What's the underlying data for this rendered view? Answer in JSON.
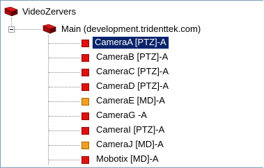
{
  "tree": {
    "root": {
      "label": "VideoZervers",
      "icon": "server-group-icon"
    },
    "server": {
      "label": "Main (development.tridenttek.com)",
      "icon": "server-icon",
      "expanded": true
    },
    "cameras": [
      {
        "label": "CameraA [PTZ]-A",
        "status_color": "#dd1111",
        "selected": true
      },
      {
        "label": "CameraB [PTZ]-A",
        "status_color": "#dd1111",
        "selected": false
      },
      {
        "label": "CameraC [PTZ]-A",
        "status_color": "#dd1111",
        "selected": false
      },
      {
        "label": "CameraD [PTZ]-A",
        "status_color": "#dd1111",
        "selected": false
      },
      {
        "label": "CameraE [MD]-A",
        "status_color": "#f0a020",
        "selected": false
      },
      {
        "label": "CameraG -A",
        "status_color": "#dd1111",
        "selected": false
      },
      {
        "label": "CameraI [PTZ]-A",
        "status_color": "#dd1111",
        "selected": false
      },
      {
        "label": "CameraJ [MD]-A",
        "status_color": "#f0a020",
        "selected": false
      },
      {
        "label": "Mobotix [MD]-A",
        "status_color": "#dd1111",
        "selected": false
      }
    ]
  },
  "colors": {
    "selection": "#0a246a",
    "camera_red": "#dd1111",
    "camera_orange": "#f0a020"
  }
}
